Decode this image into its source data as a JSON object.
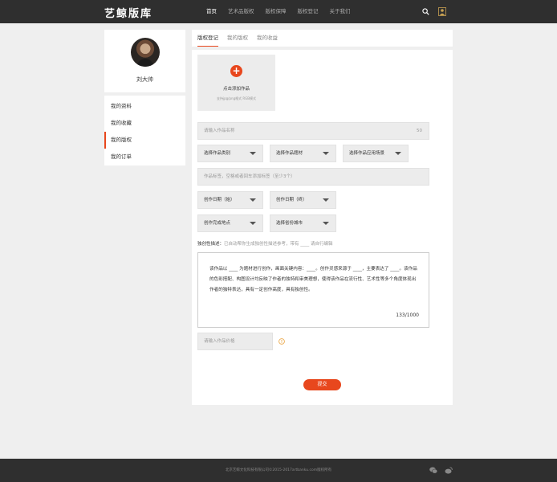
{
  "header": {
    "logo": "艺鲸版库",
    "nav": [
      "首页",
      "艺术品版权",
      "版权保障",
      "版权登记",
      "关于我们"
    ],
    "nav_active": 0
  },
  "sidebar": {
    "username": "刘大帅",
    "menu": [
      "我的资料",
      "我的收藏",
      "我的版权",
      "我的订单"
    ],
    "menu_active": 2
  },
  "tabs": [
    "版权登记",
    "我的版权",
    "我的收益"
  ],
  "tab_active": 0,
  "form": {
    "upload_label": "点击添加作品",
    "upload_hint": "支持jpg/png格式 RGB模式",
    "name_placeholder": "请输入作品名称",
    "name_limit": "50",
    "category_select": "选择作品类别",
    "subject_select": "选择作品题材",
    "scene_select": "选择作品应用场景",
    "tags_placeholder": "作品标签，空格或者回车添加标签（至少3个）",
    "start_date_select": "创作日期（始）",
    "end_date_select": "创作日期（终）",
    "location_select": "创作完成地点",
    "city_select": "选择省份城市",
    "desc_label": "独创性描述：",
    "desc_hint": "已自动帮你生成独创性描述参考，带有 ____ 请自行编辑",
    "desc_text": "该作品以 ____ 为题材进行创作，画面关键内容：____。创作灵感来源于 ____，主要表达了 ____。该作品的色彩搭配、构图设计均反映了作者的独特和审美理想，使得该作品在流行性、艺术性等多个角度体现出作者的独特表达，具有一定创作高度，具有独创性。",
    "desc_count": "133/1000",
    "price_placeholder": "请输入作品价格",
    "submit_label": "提交"
  },
  "footer": {
    "copyright": "北京艺鲸文化科技有限公司©2015-2017artbanku.com版权所有"
  },
  "colors": {
    "accent": "#e8471d",
    "topbar": "#2f2f2f",
    "page_bg": "#efefef"
  },
  "icons": [
    "search-icon",
    "user-icon",
    "plus-icon",
    "chevron-down-icon",
    "warning-icon",
    "wechat-icon",
    "weibo-icon"
  ]
}
